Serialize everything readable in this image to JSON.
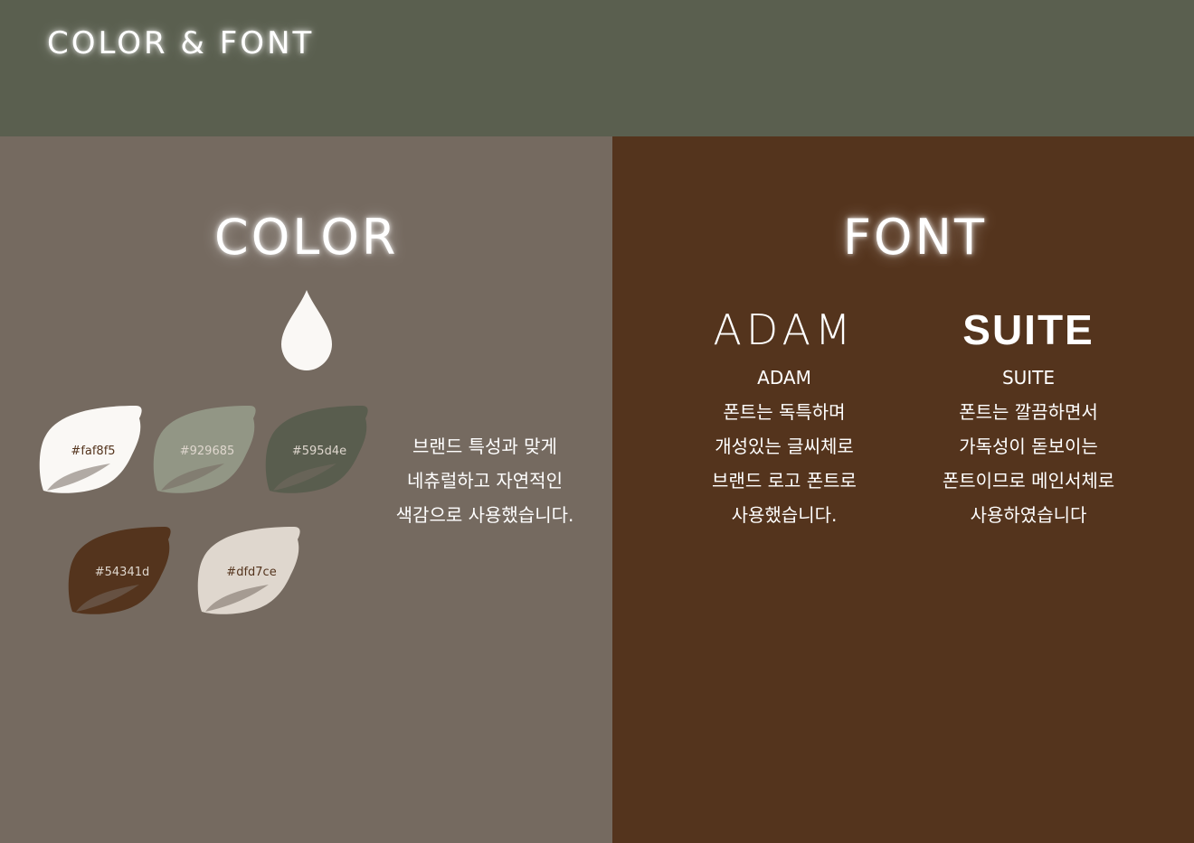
{
  "header": {
    "title": "COLOR & FONT"
  },
  "color_section": {
    "title": "COLOR",
    "icon": "drop-icon",
    "swatches": [
      {
        "label": "#faf8f5",
        "color": "#faf8f5",
        "text_color": "#54341d"
      },
      {
        "label": "#929685",
        "color": "#929685",
        "text_color": "#dfd7ce"
      },
      {
        "label": "#595d4e",
        "color": "#595d4e",
        "text_color": "#dfd7ce"
      },
      {
        "label": "#54341d",
        "color": "#54341d",
        "text_color": "#dfd7ce"
      },
      {
        "label": "#dfd7ce",
        "color": "#dfd7ce",
        "text_color": "#54341d"
      }
    ],
    "description": [
      "브랜드 특성과 맞게",
      "네츄럴하고 자연적인",
      "색감으로 사용했습니다."
    ]
  },
  "font_section": {
    "title": "FONT",
    "fonts": [
      {
        "name_large": "ADAM",
        "name_small": "ADAM",
        "description": [
          "폰트는 독특하며",
          "개성있는 글씨체로",
          "브랜드 로고 폰트로",
          "사용했습니다."
        ]
      },
      {
        "name_large": "SUITE",
        "name_small": "SUITE",
        "description": [
          "폰트는 깔끔하면서",
          "가독성이 돋보이는",
          "폰트이므로 메인서체로",
          "사용하였습니다"
        ]
      }
    ]
  },
  "colors": {
    "header_bg": "#5a5f4f",
    "color_panel_bg": "#756a60",
    "font_panel_bg": "#54341d",
    "drop_fill": "#faf8f5"
  }
}
